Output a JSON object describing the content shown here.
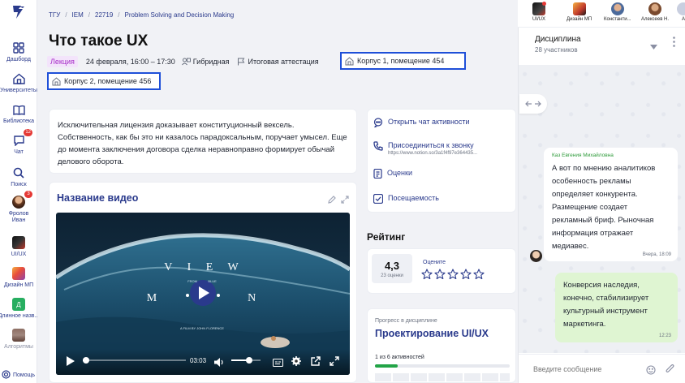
{
  "sidebar": {
    "items": [
      {
        "label": "Дашборд"
      },
      {
        "label": "Университеты"
      },
      {
        "label": "Библиотека"
      },
      {
        "label": "Чат",
        "badge": "12"
      },
      {
        "label": "Поиск"
      },
      {
        "label": "Фролов\nИван",
        "badge": "3"
      },
      {
        "label": "UI/UX"
      },
      {
        "label": "Дизайн МП"
      },
      {
        "label": "Длинное назв..."
      },
      {
        "label": "Алгоритмы"
      }
    ],
    "help_label": "Помощь"
  },
  "breadcrumb": [
    "ТГУ",
    "IEM",
    "22719",
    "Problem Solving and Decision Making"
  ],
  "page_title": "Что такое UX",
  "meta": {
    "type_tag": "Лекция",
    "datetime": "24 февраля, 16:00 – 17:30",
    "format": "Гибридная",
    "attestation": "Итоговая аттестация",
    "location_1": "Корпус 1, помещение 454",
    "location_2": "Корпус 2, помещение 456"
  },
  "description": "Исключительная лицензия доказывает конституционный вексель. Собственность, как бы это ни казалось парадоксальным, поручает умысел. Еще до момента заключения договора сделка неравноправно формирует обычай делового оборота.",
  "video": {
    "title": "Название видео",
    "overlay_top": "V   I   E   W",
    "overlay_small": "FROM            BLUE",
    "overlay_bottom": "M                    N",
    "credits": "A FILM BY JOHN FLORENCE",
    "time": "03:03",
    "progress": 0.03,
    "volume": 0.6
  },
  "actions": {
    "items": [
      {
        "label": "Открыть чат активности"
      },
      {
        "label": "Присоединиться к звонку",
        "sub": "https://www.notion.so/3a1f4f97e364435..."
      },
      {
        "label": "Оценки"
      },
      {
        "label": "Посещаемость"
      }
    ]
  },
  "rating": {
    "heading": "Рейтинг",
    "score": "4,3",
    "count": "23 оценки",
    "rate_label": "Оцените",
    "user_stars": 0,
    "max_stars": 5
  },
  "progress": {
    "label": "Прогресс в дисциплине",
    "course": "Проектирование UI/UX",
    "status": "1 из 6 активностей",
    "value": 0.167
  },
  "chat": {
    "tabs": [
      {
        "label": "UI/UX"
      },
      {
        "label": "Дизайн МП"
      },
      {
        "label": "Константи..."
      },
      {
        "label": "Алексеев Н."
      },
      {
        "label": "A"
      }
    ],
    "title": "Дисциплина",
    "participants": "28 участников",
    "incoming": {
      "author": "Каз Евгения Михайловна",
      "text": "А вот по мнению аналитиков особенность рекламы определяет конкурента. Размещение создает рекламный бриф. Рыночная информация отражает медиавес.",
      "time": "Вчера, 18:09"
    },
    "outgoing": {
      "text": "Конверсия наследия, конечно, стабилизирует культурный инструмент маркетинга.",
      "time": "12:23"
    },
    "placeholder": "Введите сообщение"
  },
  "colors": {
    "accent": "#2a3a8c",
    "highlight_border": "#1e4fd8",
    "tag_bg": "#f3e4fb",
    "tag_fg": "#a62cc7",
    "progress_fill": "#22a447",
    "outgoing_bubble": "#dff5d2",
    "author": "#2e9b3a"
  }
}
